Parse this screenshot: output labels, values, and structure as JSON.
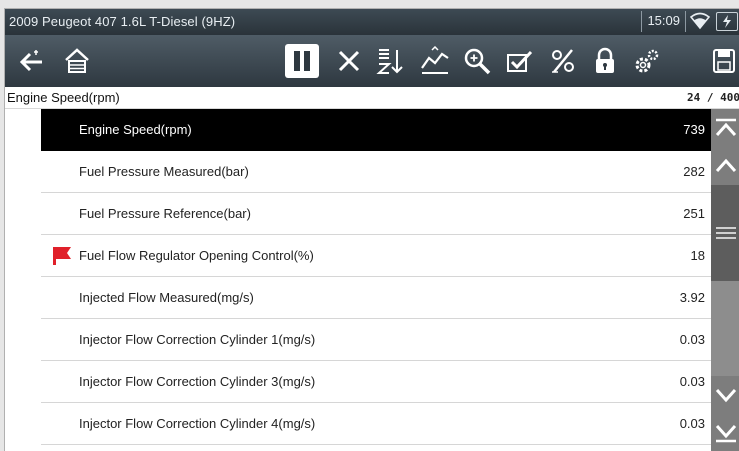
{
  "status_bar": {
    "title": "2009 Peugeot 407 1.6L T-Diesel (9HZ)",
    "time": "15:09"
  },
  "toolbar": {
    "icons": [
      "back-icon",
      "home-icon",
      "pause-icon",
      "close-icon",
      "sort-icon",
      "graph-icon",
      "zoom-icon",
      "check-icon",
      "percent-icon",
      "lock-icon",
      "settings-icon",
      "save-icon"
    ]
  },
  "header": {
    "selected_label": "Engine Speed(rpm)",
    "count": "24 / 400"
  },
  "rows": [
    {
      "name": "Engine Speed(rpm)",
      "value": "739",
      "selected": true,
      "flagged": false
    },
    {
      "name": "Fuel Pressure Measured(bar)",
      "value": "282",
      "selected": false,
      "flagged": false
    },
    {
      "name": "Fuel Pressure Reference(bar)",
      "value": "251",
      "selected": false,
      "flagged": false
    },
    {
      "name": "Fuel Flow Regulator Opening Control(%)",
      "value": "18",
      "selected": false,
      "flagged": true
    },
    {
      "name": "Injected Flow Measured(mg/s)",
      "value": "3.92",
      "selected": false,
      "flagged": false
    },
    {
      "name": "Injector Flow Correction Cylinder 1(mg/s)",
      "value": "0.03",
      "selected": false,
      "flagged": false
    },
    {
      "name": "Injector Flow Correction Cylinder 3(mg/s)",
      "value": "0.03",
      "selected": false,
      "flagged": false
    },
    {
      "name": "Injector Flow Correction Cylinder 4(mg/s)",
      "value": "0.03",
      "selected": false,
      "flagged": false
    }
  ],
  "colors": {
    "selected_row_bg": "#000000",
    "flag": "#e0202a",
    "toolbar_bg": "#3a454e"
  }
}
